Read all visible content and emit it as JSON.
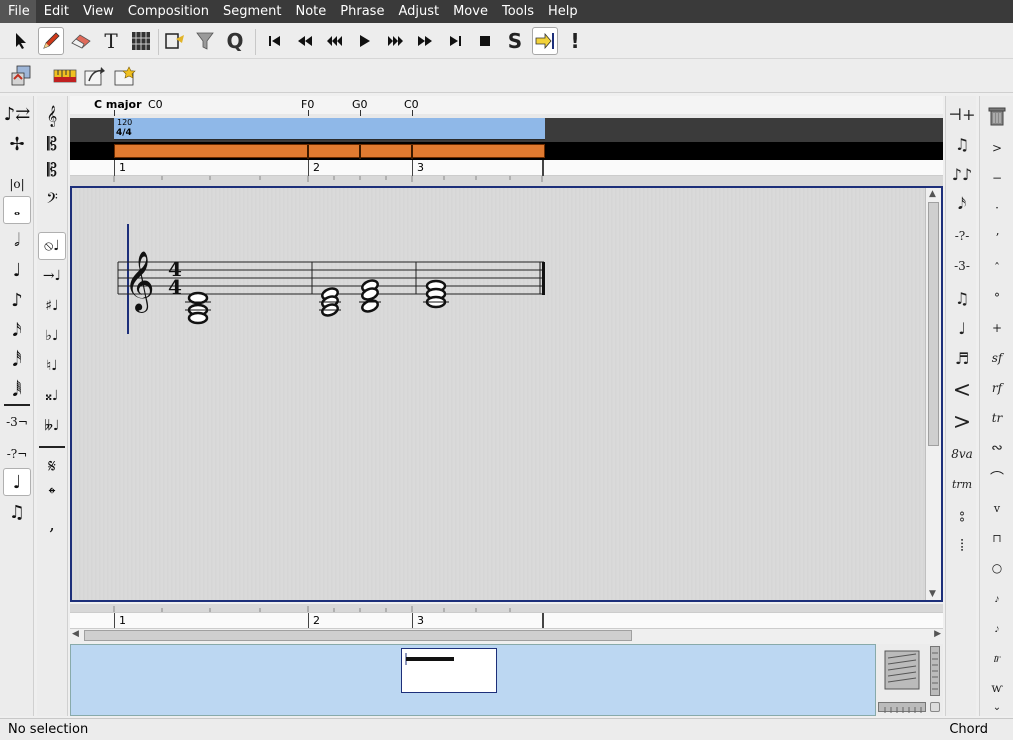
{
  "menubar": {
    "items": [
      "File",
      "Edit",
      "View",
      "Composition",
      "Segment",
      "Note",
      "Phrase",
      "Adjust",
      "Move",
      "Tools",
      "Help"
    ]
  },
  "ruler": {
    "key_label": "C major",
    "chords": [
      "C0",
      "F0",
      "G0",
      "C0"
    ],
    "tempo": "120",
    "time_signature": "4/4",
    "bar_numbers": [
      "1",
      "2",
      "3"
    ]
  },
  "bottom_ruler": {
    "bar_numbers": [
      "1",
      "2",
      "3"
    ]
  },
  "score": {
    "time_signature_top": "4",
    "time_signature_bottom": "4",
    "clef": "treble"
  },
  "status": {
    "left": "No selection",
    "right": "Chord"
  },
  "colors": {
    "menubar_bg": "#3a3a3a",
    "tempo_bar": "#8fb8e8",
    "segment_bar": "#e07a30",
    "panner_bg": "#bcd7f2",
    "canvas_border": "#1d2f7a"
  },
  "icons": {
    "toolbar_edit": [
      "select-arrow-icon",
      "draw-pencil-icon",
      "erase-icon",
      "text-icon",
      "guitar-chord-icon",
      "symbol-insert-icon",
      "filter-funnel-icon",
      "quantize-icon"
    ],
    "transport": [
      "rewind-to-start-icon",
      "rewind-icon",
      "fast-rewind-icon",
      "play-icon",
      "fast-forward-icon",
      "forward-icon",
      "forward-to-end-icon",
      "stop-icon",
      "solo-icon",
      "cursor-to-playback-icon",
      "panic-icon"
    ],
    "toolbar2": [
      "segment-parameters-icon",
      "ruler-icon",
      "jump-icon",
      "add-marker-icon"
    ]
  }
}
